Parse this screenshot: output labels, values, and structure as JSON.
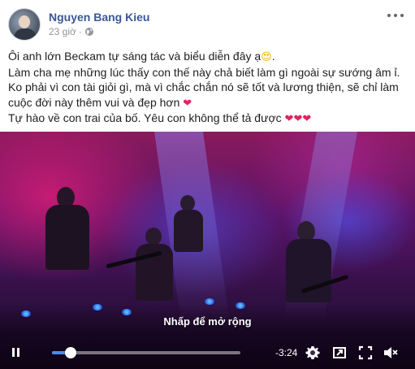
{
  "post": {
    "author": "Nguyen Bang Kieu",
    "time": "23 giờ",
    "separator": "·",
    "privacy_icon": "globe-icon",
    "more_icon": "more-options-icon"
  },
  "caption": {
    "line1": "Ôi anh lớn Beckam tự sáng tác và biểu diễn đây ạ",
    "line1_end": ".",
    "line2": "Làm cha mẹ những lúc thấy con thế này chả biết làm gì ngoài sự sướng âm ỉ.",
    "line3": "Ko phải vì con tài giỏi gì, mà vì chắc chắn nó sẽ tốt và lương thiện, sẽ chỉ làm",
    "line4": "cuộc đời này thêm vui và đẹp hơn",
    "line5": "Tự hào về con trai của bố. Yêu con không thể tả được",
    "emoji_heart_eyes": "😍",
    "emoji_heart": "❤",
    "emoji_hearts": "❤❤❤"
  },
  "video": {
    "hint": "Nhấp để mở rộng",
    "remaining_time": "-3:24",
    "progress": 0.1,
    "colors": {
      "accent": "#4b8af5",
      "stage_pink": "#e61e78",
      "stage_blue": "#5050e6"
    }
  },
  "controls": {
    "pause_icon": "pause-icon",
    "settings_icon": "gear-icon",
    "fullscreen_icon": "fullscreen-icon",
    "expand_icon": "expand-icon",
    "volume_icon": "volume-muted-icon"
  }
}
